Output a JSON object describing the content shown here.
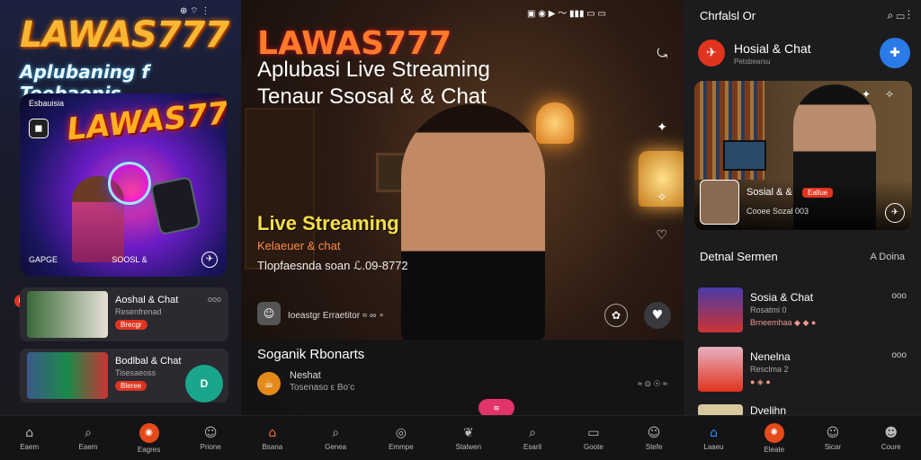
{
  "left": {
    "status_right": "⊕ ⌔ ⋮",
    "status_left": "",
    "brand": "LAWAS777",
    "subtitle": "Aplubaning f Teebaenis",
    "card": {
      "header": "Esbauisia",
      "brand": "LAWAS777",
      "foot_left": "GAPGE",
      "foot_mid": "SOOSL",
      "foot_mid2": "&",
      "btn": "✈"
    },
    "bubble": "8",
    "items": [
      {
        "title": "Aoshal & Chat",
        "meta": "Resenfrenad",
        "pill": "Brecgr",
        "more": "ooo"
      },
      {
        "title": "Bodlbal & Chat",
        "meta": "Tisesaeoss",
        "pill": "Bleree"
      }
    ],
    "fab": "D",
    "nav": [
      {
        "icon": "home-icon",
        "label": "Eaem"
      },
      {
        "icon": "search-icon",
        "label": "Eaem"
      },
      {
        "icon": "live-icon",
        "label": "Eagres",
        "active": true
      },
      {
        "icon": "profile-icon",
        "label": "Prione"
      }
    ]
  },
  "middle": {
    "status": "▣ ◉ ▶ 〜 ▮▮▮ ▭ ▭",
    "brand": "LAWAS777",
    "title1": "Aplubasi Live Streaming",
    "title2": "Tenaur Ssosal & & Chat",
    "live_title": "Live Streaming",
    "live_sub": "Kelaeuer & chat",
    "live_desc": "Tlopfaesnda soan ℒ.09-8772",
    "chip_label": "Ioeastgr Erraetitor",
    "chip_extra": "≈ ∞ ∘",
    "section": "Soganik Rbonarts",
    "row_title": "Neshat",
    "row_meta": "Tosenaso ε Boʻc",
    "row_right": "≈ ⊙ ☉ ≈",
    "pill": "≋",
    "nav": [
      {
        "icon": "home-icon",
        "label": "Bsana",
        "active": true
      },
      {
        "icon": "search-icon",
        "label": "Genea"
      },
      {
        "icon": "live-icon",
        "label": "Emmpe"
      },
      {
        "icon": "leaf-icon",
        "label": "Stalwen"
      },
      {
        "icon": "search-icon",
        "label": "Esaril"
      },
      {
        "icon": "chat-icon",
        "label": "Goote"
      },
      {
        "icon": "profile-icon",
        "label": "Stefe"
      }
    ]
  },
  "right": {
    "top_title": "Chrfalsl Or",
    "top_icons": "⌕ ▭ ⋮",
    "header_title": "Hosial & Chat",
    "header_sub": "Petsbearsu",
    "card": {
      "title": "Sosial & &",
      "tag": "Eallue",
      "meta": "Cooee Sozal 003",
      "ic1": "✦",
      "ic2": "✧"
    },
    "section": "Detnal Sermen",
    "section_right": "A Doina",
    "items": [
      {
        "title": "Sosia & Chat",
        "meta": "Rosatmi 0",
        "icons": "Brneemhaa ◆ ◆ ●",
        "more": "ooo"
      },
      {
        "title": "Nenelna",
        "meta": "Resclma 2",
        "icons": "● ◈ ●",
        "more": "ooo"
      },
      {
        "title": "Dvelihn",
        "meta": "",
        "icons": ""
      }
    ],
    "nav": [
      {
        "icon": "home-icon",
        "label": "Laaeu",
        "active": true
      },
      {
        "icon": "live-icon",
        "label": "Eleate"
      },
      {
        "icon": "profile-icon",
        "label": "Sicar"
      },
      {
        "icon": "profile-icon",
        "label": "Coure"
      }
    ]
  },
  "colors": {
    "accent_orange": "#ff6a2b",
    "accent_red": "#e0341f",
    "accent_blue": "#2a7ae8",
    "accent_teal": "#1aa68a"
  }
}
